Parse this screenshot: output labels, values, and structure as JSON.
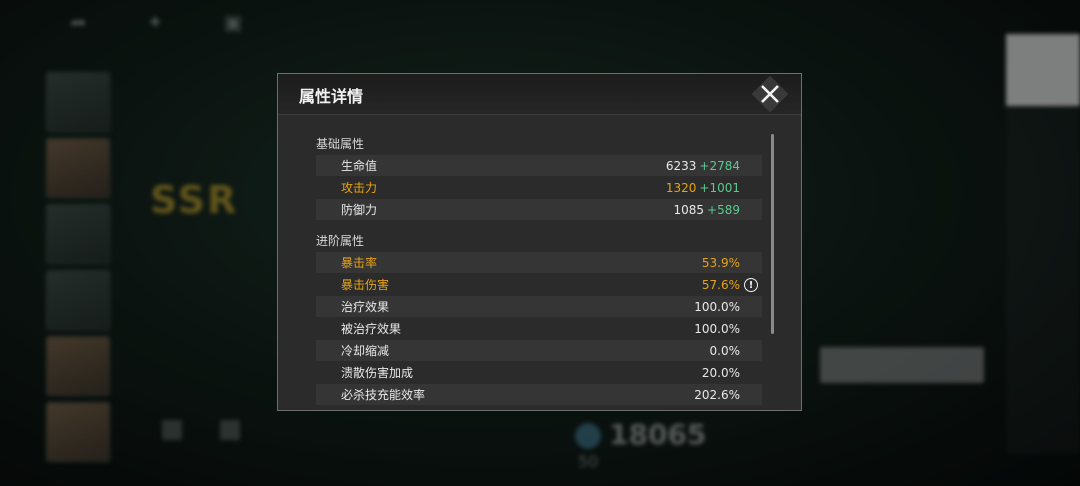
{
  "dialog": {
    "title": "属性详情",
    "close_icon": "close-icon"
  },
  "basic": {
    "section_title": "基础属性",
    "rows": [
      {
        "label": "生命值",
        "value": "6233",
        "bonus": "+2784"
      },
      {
        "label": "攻击力",
        "value": "1320",
        "bonus": "+1001"
      },
      {
        "label": "防御力",
        "value": "1085",
        "bonus": "+589"
      }
    ]
  },
  "advanced": {
    "section_title": "进阶属性",
    "rows": [
      {
        "label": "暴击率",
        "value": "53.9%"
      },
      {
        "label": "暴击伤害",
        "value": "57.6%"
      },
      {
        "label": "治疗效果",
        "value": "100.0%"
      },
      {
        "label": "被治疗效果",
        "value": "100.0%"
      },
      {
        "label": "冷却缩减",
        "value": "0.0%"
      },
      {
        "label": "溃散伤害加成",
        "value": "20.0%"
      },
      {
        "label": "必杀技充能效率",
        "value": "202.6%"
      }
    ]
  },
  "colors": {
    "highlight_gold": "#e6a317",
    "bonus_green": "#5cc98e"
  },
  "background": {
    "rarity": "SSR",
    "power": "18065",
    "level": "50"
  }
}
